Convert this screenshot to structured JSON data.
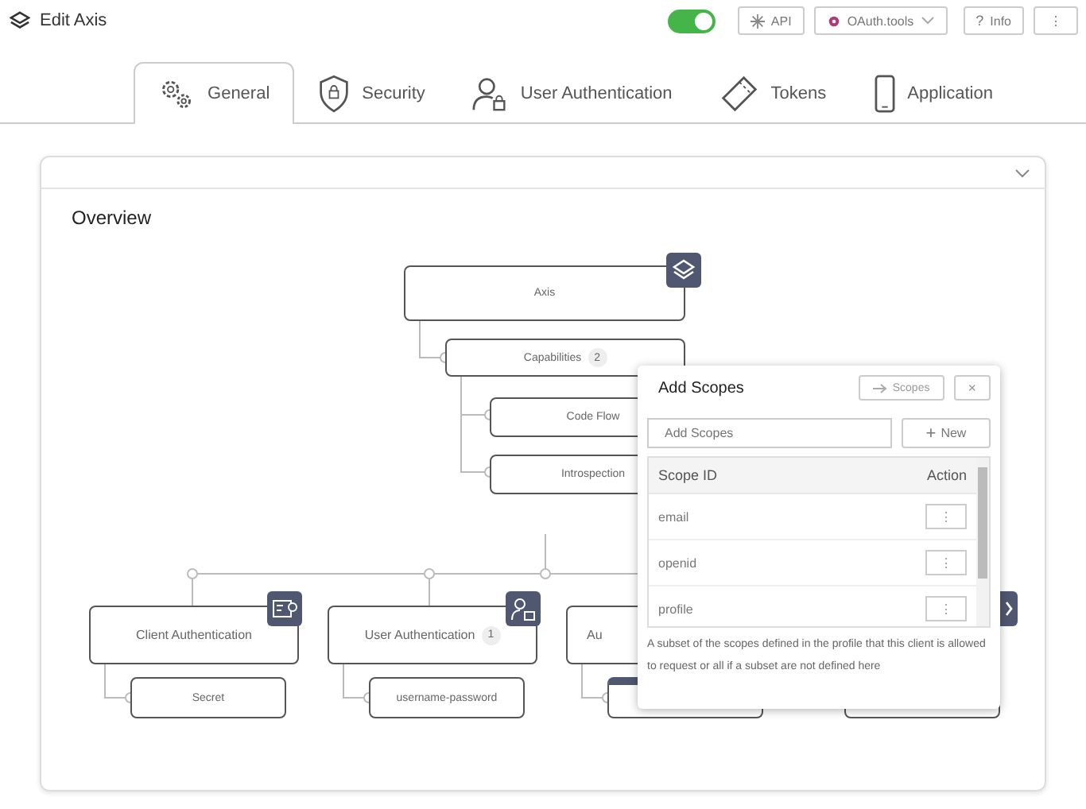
{
  "header": {
    "title": "Edit Axis",
    "toggle": {
      "on": true
    },
    "buttons": [
      {
        "kind": "api",
        "label": "API"
      },
      {
        "kind": "oauth",
        "label": "OAuth.tools"
      },
      {
        "kind": "info",
        "label": "Info",
        "icon": "?"
      },
      {
        "kind": "more",
        "label": "⋮"
      }
    ]
  },
  "tabs": [
    {
      "kind": "gears",
      "label": "General",
      "selected": true
    },
    {
      "kind": "shield",
      "label": "Security",
      "selected": false
    },
    {
      "kind": "user",
      "label": "User Authentication",
      "selected": false
    },
    {
      "kind": "ticket",
      "label": "Tokens",
      "selected": false
    },
    {
      "kind": "phone",
      "label": "Application",
      "selected": false
    }
  ],
  "card": {
    "title": "Overview",
    "diagram": {
      "root": {
        "label": "Axis"
      },
      "capabilities": {
        "label": "Capabilities",
        "count": "2",
        "items": [
          {
            "label": "Code Flow"
          },
          {
            "label": "Introspection"
          }
        ]
      },
      "groups": [
        {
          "label": "Client Authentication",
          "children": [
            {
              "label": "Secret"
            }
          ]
        },
        {
          "label": "User Authentication",
          "count": "1",
          "children": [
            {
              "label": "username-password"
            }
          ]
        },
        {
          "label": "Au"
        }
      ]
    },
    "popup": {
      "title": "Add Scopes",
      "link": "Scopes",
      "close": "×",
      "placeholder": "Add Scopes",
      "new": "New",
      "plus": "+",
      "columns": [
        "Scope ID",
        "Action"
      ],
      "rows": [
        {
          "scope": "email",
          "action": "⋮"
        },
        {
          "scope": "openid",
          "action": "⋮"
        },
        {
          "scope": "profile",
          "action": "⋮"
        }
      ],
      "description": "A subset of the scopes defined in the profile that this client is allowed to request or all if a subset are not defined here"
    }
  }
}
